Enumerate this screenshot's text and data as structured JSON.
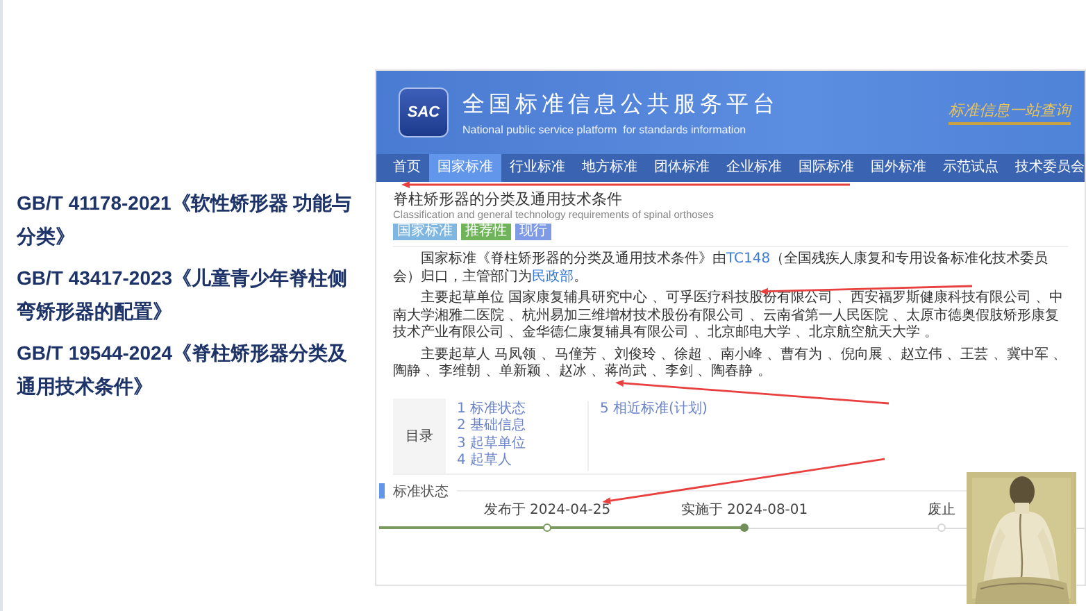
{
  "slide": {
    "standards": [
      "GB/T 41178-2021《软性矫形器 功能与分类》",
      "GB/T 43417-2023《儿童青少年脊柱侧弯矫形器的配置》",
      "GB/T 19544-2024《脊柱矫形器分类及通用技术条件》"
    ]
  },
  "website": {
    "logo": "SAC",
    "platform_name": "全国标准信息公共服务平台",
    "platform_name_en": "National public service platform  for standards information",
    "slogan": "标准信息一站查询",
    "nav": [
      {
        "label": "首页",
        "selected": false
      },
      {
        "label": "国家标准",
        "selected": true
      },
      {
        "label": "行业标准",
        "selected": false
      },
      {
        "label": "地方标准",
        "selected": false
      },
      {
        "label": "团体标准",
        "selected": false
      },
      {
        "label": "企业标准",
        "selected": false
      },
      {
        "label": "国际标准",
        "selected": false
      },
      {
        "label": "国外标准",
        "selected": false
      },
      {
        "label": "示范试点",
        "selected": false
      },
      {
        "label": "技术委员会",
        "selected": false
      }
    ],
    "standard": {
      "title": "脊柱矫形器的分类及通用技术条件",
      "title_en": "Classification and general technology requirements of spinal orthoses",
      "tags": [
        {
          "label": "国家标准",
          "color": "#7fb7e0"
        },
        {
          "label": "推荐性",
          "color": "#6fb35a"
        },
        {
          "label": "现行",
          "color": "#7f9be6"
        }
      ],
      "paragraphs": [
        [
          {
            "kind": "text",
            "text": "国家标准《脊柱矫形器的分类及通用技术条件》由"
          },
          {
            "kind": "link",
            "text": "TC148"
          },
          {
            "kind": "text",
            "text": "（全国残疾人康复和专用设备标准化技术委员会）归口，主管部门为"
          },
          {
            "kind": "link",
            "text": "民政部"
          },
          {
            "kind": "text",
            "text": "。"
          }
        ],
        [
          {
            "kind": "text",
            "text": "主要起草单位 国家康复辅具研究中心 、可孚医疗科技股份有限公司 、西安福罗斯健康科技有限公司 、中南大学湘雅二医院 、杭州易加三维增材技术股份有限公司 、云南省第一人民医院 、太原市德奥假肢矫形康复技术产业有限公司 、金华德仁康复辅具有限公司 、北京邮电大学 、北京航空航天大学 。"
          }
        ],
        [
          {
            "kind": "text",
            "text": "主要起草人 马凤领 、马僮芳 、刘俊玲 、徐超 、南小峰 、曹有为 、倪向展 、赵立伟 、王芸 、冀中军 、陶静 、李维朝 、单新颖 、赵冰 、蒋尚武 、李剑 、陶春静 。"
          }
        ]
      ]
    },
    "toc": {
      "label": "目录",
      "columns": [
        [
          "1 标准状态",
          "2 基础信息",
          "3 起草单位",
          "4 起草人"
        ],
        [
          "5 相近标准(计划)"
        ]
      ]
    },
    "status_heading": "标准状态",
    "timeline": [
      {
        "label": "发布于 2024-04-25",
        "kind": "passed"
      },
      {
        "label": "实施于 2024-08-01",
        "kind": "current"
      },
      {
        "label": "废止",
        "kind": "future"
      }
    ]
  }
}
